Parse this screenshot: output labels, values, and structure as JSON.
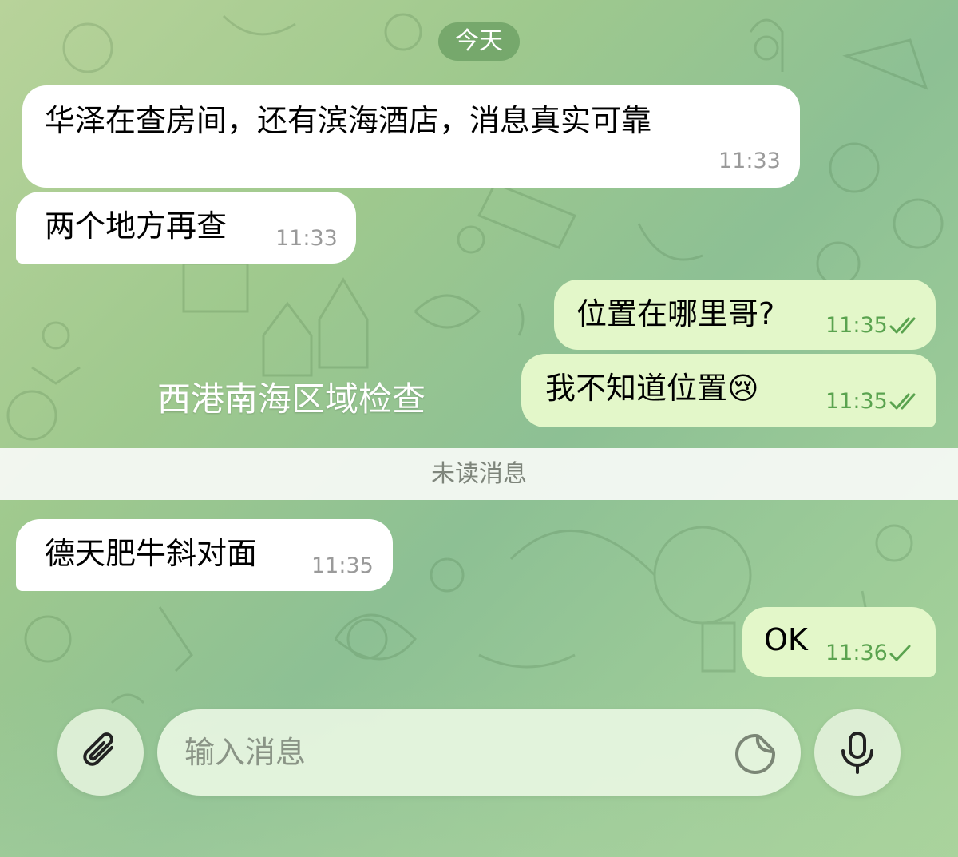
{
  "date_header": "今天",
  "caption_overlay": "西港南海区域检查",
  "unread_divider": "未读消息",
  "messages": [
    {
      "direction": "in",
      "text": "华泽在查房间，还有滨海酒店，消息真实可靠",
      "time": "11:33"
    },
    {
      "direction": "in",
      "text": "两个地方再查",
      "time": "11:33"
    },
    {
      "direction": "out",
      "text": "位置在哪里哥?",
      "time": "11:35",
      "status": "read"
    },
    {
      "direction": "out",
      "text": "我不知道位置😢",
      "time": "11:35",
      "status": "read"
    },
    {
      "direction": "in",
      "text": "德天肥牛斜对面",
      "time": "11:35"
    },
    {
      "direction": "out",
      "text": "OK",
      "time": "11:36",
      "status": "sent"
    }
  ],
  "composer": {
    "placeholder": "输入消息",
    "attach_icon": "paperclip-icon",
    "sticker_icon": "sticker-icon",
    "mic_icon": "microphone-icon"
  },
  "colors": {
    "incoming_bubble": "#ffffff",
    "outgoing_bubble": "#e3f7c9",
    "outgoing_time": "#5aa34f",
    "incoming_time": "#9a9a9a",
    "date_pill": "#6fa565"
  }
}
